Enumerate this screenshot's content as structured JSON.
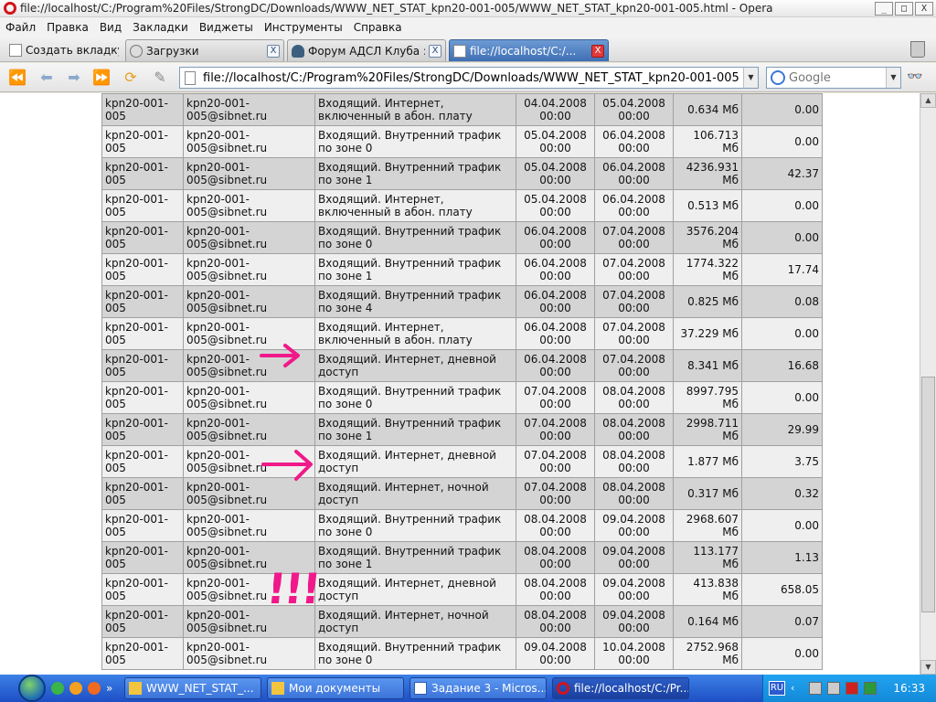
{
  "window": {
    "title": "file://localhost/C:/Program%20Files/StrongDC/Downloads/WWW_NET_STAT_kpn20-001-005/WWW_NET_STAT_kpn20-001-005.html - Opera",
    "minimize": "_",
    "maximize": "□",
    "close": "X"
  },
  "menu": [
    "Файл",
    "Правка",
    "Вид",
    "Закладки",
    "Виджеты",
    "Инструменты",
    "Справка"
  ],
  "tabs": {
    "new_tab": "Создать вкладку",
    "items": [
      {
        "label": "Загрузки",
        "close": "X"
      },
      {
        "label": "Форум АДСЛ Клуба ::...",
        "close": "X"
      },
      {
        "label": "file://localhost/C:/...",
        "close": "X"
      }
    ]
  },
  "nav": {
    "address": "file://localhost/C:/Program%20Files/StrongDC/Downloads/WWW_NET_STAT_kpn20-001-005",
    "search_placeholder": "Google"
  },
  "table": {
    "rows": [
      {
        "login": "kpn20-001-005",
        "email": "kpn20-001-005@sibnet.ru",
        "service": "Входящий. Интернет, включенный в абон. плату",
        "start_date": "04.04.2008",
        "start_time": "00:00",
        "end_date": "05.04.2008",
        "end_time": "00:00",
        "volume": "0.634 Мб",
        "cost": "0.00"
      },
      {
        "login": "kpn20-001-005",
        "email": "kpn20-001-005@sibnet.ru",
        "service": "Входящий. Внутренний трафик по зоне 0",
        "start_date": "05.04.2008",
        "start_time": "00:00",
        "end_date": "06.04.2008",
        "end_time": "00:00",
        "volume": "106.713 Мб",
        "cost": "0.00"
      },
      {
        "login": "kpn20-001-005",
        "email": "kpn20-001-005@sibnet.ru",
        "service": "Входящий. Внутренний трафик по зоне 1",
        "start_date": "05.04.2008",
        "start_time": "00:00",
        "end_date": "06.04.2008",
        "end_time": "00:00",
        "volume": "4236.931 Мб",
        "cost": "42.37"
      },
      {
        "login": "kpn20-001-005",
        "email": "kpn20-001-005@sibnet.ru",
        "service": "Входящий. Интернет, включенный в абон. плату",
        "start_date": "05.04.2008",
        "start_time": "00:00",
        "end_date": "06.04.2008",
        "end_time": "00:00",
        "volume": "0.513 Мб",
        "cost": "0.00"
      },
      {
        "login": "kpn20-001-005",
        "email": "kpn20-001-005@sibnet.ru",
        "service": "Входящий. Внутренний трафик по зоне 0",
        "start_date": "06.04.2008",
        "start_time": "00:00",
        "end_date": "07.04.2008",
        "end_time": "00:00",
        "volume": "3576.204 Мб",
        "cost": "0.00"
      },
      {
        "login": "kpn20-001-005",
        "email": "kpn20-001-005@sibnet.ru",
        "service": "Входящий. Внутренний трафик по зоне 1",
        "start_date": "06.04.2008",
        "start_time": "00:00",
        "end_date": "07.04.2008",
        "end_time": "00:00",
        "volume": "1774.322 Мб",
        "cost": "17.74"
      },
      {
        "login": "kpn20-001-005",
        "email": "kpn20-001-005@sibnet.ru",
        "service": "Входящий. Внутренний трафик по зоне 4",
        "start_date": "06.04.2008",
        "start_time": "00:00",
        "end_date": "07.04.2008",
        "end_time": "00:00",
        "volume": "0.825 Мб",
        "cost": "0.08"
      },
      {
        "login": "kpn20-001-005",
        "email": "kpn20-001-005@sibnet.ru",
        "service": "Входящий. Интернет, включенный в абон. плату",
        "start_date": "06.04.2008",
        "start_time": "00:00",
        "end_date": "07.04.2008",
        "end_time": "00:00",
        "volume": "37.229 Мб",
        "cost": "0.00"
      },
      {
        "login": "kpn20-001-005",
        "email": "kpn20-001-005@sibnet.ru",
        "service": "Входящий. Интернет, дневной доступ",
        "start_date": "06.04.2008",
        "start_time": "00:00",
        "end_date": "07.04.2008",
        "end_time": "00:00",
        "volume": "8.341 Мб",
        "cost": "16.68"
      },
      {
        "login": "kpn20-001-005",
        "email": "kpn20-001-005@sibnet.ru",
        "service": "Входящий. Внутренний трафик по зоне 0",
        "start_date": "07.04.2008",
        "start_time": "00:00",
        "end_date": "08.04.2008",
        "end_time": "00:00",
        "volume": "8997.795 Мб",
        "cost": "0.00"
      },
      {
        "login": "kpn20-001-005",
        "email": "kpn20-001-005@sibnet.ru",
        "service": "Входящий. Внутренний трафик по зоне 1",
        "start_date": "07.04.2008",
        "start_time": "00:00",
        "end_date": "08.04.2008",
        "end_time": "00:00",
        "volume": "2998.711 Мб",
        "cost": "29.99"
      },
      {
        "login": "kpn20-001-005",
        "email": "kpn20-001-005@sibnet.ru",
        "service": "Входящий. Интернет, дневной доступ",
        "start_date": "07.04.2008",
        "start_time": "00:00",
        "end_date": "08.04.2008",
        "end_time": "00:00",
        "volume": "1.877 Мб",
        "cost": "3.75"
      },
      {
        "login": "kpn20-001-005",
        "email": "kpn20-001-005@sibnet.ru",
        "service": "Входящий. Интернет, ночной доступ",
        "start_date": "07.04.2008",
        "start_time": "00:00",
        "end_date": "08.04.2008",
        "end_time": "00:00",
        "volume": "0.317 Мб",
        "cost": "0.32"
      },
      {
        "login": "kpn20-001-005",
        "email": "kpn20-001-005@sibnet.ru",
        "service": "Входящий. Внутренний трафик по зоне 0",
        "start_date": "08.04.2008",
        "start_time": "00:00",
        "end_date": "09.04.2008",
        "end_time": "00:00",
        "volume": "2968.607 Мб",
        "cost": "0.00"
      },
      {
        "login": "kpn20-001-005",
        "email": "kpn20-001-005@sibnet.ru",
        "service": "Входящий. Внутренний трафик по зоне 1",
        "start_date": "08.04.2008",
        "start_time": "00:00",
        "end_date": "09.04.2008",
        "end_time": "00:00",
        "volume": "113.177 Мб",
        "cost": "1.13"
      },
      {
        "login": "kpn20-001-005",
        "email": "kpn20-001-005@sibnet.ru",
        "service": "Входящий. Интернет, дневной доступ",
        "start_date": "08.04.2008",
        "start_time": "00:00",
        "end_date": "09.04.2008",
        "end_time": "00:00",
        "volume": "413.838 Мб",
        "cost": "658.05"
      },
      {
        "login": "kpn20-001-005",
        "email": "kpn20-001-005@sibnet.ru",
        "service": "Входящий. Интернет, ночной доступ",
        "start_date": "08.04.2008",
        "start_time": "00:00",
        "end_date": "09.04.2008",
        "end_time": "00:00",
        "volume": "0.164 Мб",
        "cost": "0.07"
      },
      {
        "login": "kpn20-001-005",
        "email": "kpn20-001-005@sibnet.ru",
        "service": "Входящий. Внутренний трафик по зоне 0",
        "start_date": "09.04.2008",
        "start_time": "00:00",
        "end_date": "10.04.2008",
        "end_time": "00:00",
        "volume": "2752.968 Мб",
        "cost": "0.00"
      }
    ]
  },
  "annotations": {
    "marks": "!!!",
    "color": "#f0198a"
  },
  "taskbar": {
    "items": [
      {
        "label": "WWW_NET_STAT_..."
      },
      {
        "label": "Мои документы"
      },
      {
        "label": "Задание 3 - Micros..."
      },
      {
        "label": "file://localhost/C:/Pr..."
      }
    ],
    "lang": "RU",
    "clock": "16:33"
  }
}
